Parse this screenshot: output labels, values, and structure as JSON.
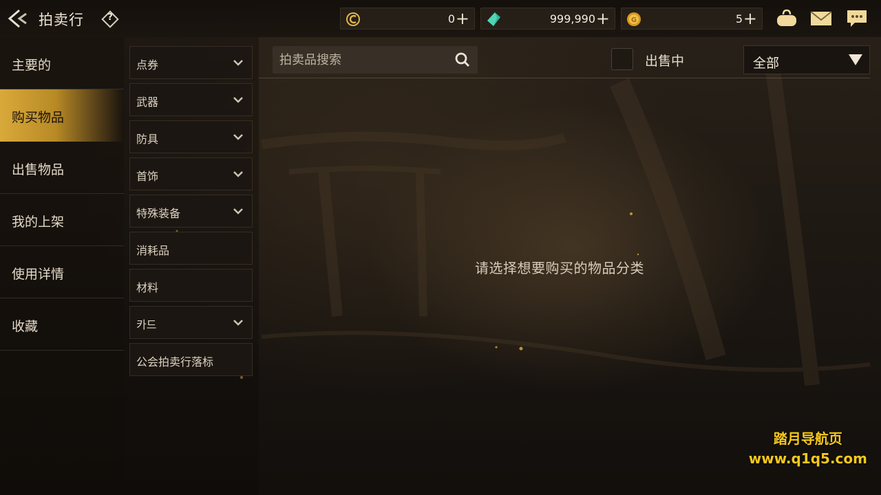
{
  "header": {
    "title": "拍卖行",
    "help_label": "?"
  },
  "currencies": [
    {
      "icon": "c-coin-icon",
      "value": "0",
      "plus": "+"
    },
    {
      "icon": "green-gem-icon",
      "value": "999,990",
      "plus": "+"
    },
    {
      "icon": "gold-coin-icon",
      "value": "5",
      "plus": "+"
    }
  ],
  "top_icons": [
    "bag-icon",
    "mail-icon",
    "chat-icon"
  ],
  "sidebar": {
    "items": [
      {
        "label": "主要的",
        "active": false
      },
      {
        "label": "购买物品",
        "active": true
      },
      {
        "label": "出售物品",
        "active": false
      },
      {
        "label": "我的上架",
        "active": false
      },
      {
        "label": "使用详情",
        "active": false
      },
      {
        "label": "收藏",
        "active": false
      }
    ]
  },
  "categories": [
    {
      "label": "点券",
      "expandable": true
    },
    {
      "label": "武器",
      "expandable": true
    },
    {
      "label": "防具",
      "expandable": true
    },
    {
      "label": "首饰",
      "expandable": true
    },
    {
      "label": "特殊装备",
      "expandable": true
    },
    {
      "label": "消耗品",
      "expandable": false
    },
    {
      "label": "材料",
      "expandable": false
    },
    {
      "label": "카드",
      "expandable": true
    },
    {
      "label": "公会拍卖行落标",
      "expandable": false
    }
  ],
  "search": {
    "placeholder": "拍卖品搜索",
    "value": ""
  },
  "filter": {
    "on_sale_label": "出售中",
    "on_sale_checked": false,
    "dropdown_selected": "全部"
  },
  "main": {
    "empty_message": "请选择想要购买的物品分类"
  },
  "watermark": {
    "line1": "踏月导航页",
    "line2": "www.q1q5.com"
  },
  "colors": {
    "accent_gold": "#d9a93a",
    "watermark": "#f6c81c"
  }
}
